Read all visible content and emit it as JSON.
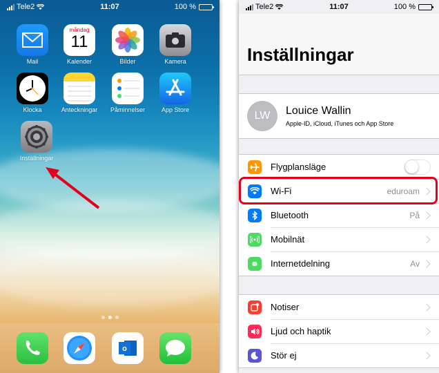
{
  "home": {
    "status": {
      "carrier": "Tele2",
      "time": "11:07",
      "battery": "100 %"
    },
    "apps": [
      {
        "label": "Mail",
        "icon": "mail-icon"
      },
      {
        "label": "Kalender",
        "icon": "calendar-icon",
        "weekday": "måndag",
        "day": "11"
      },
      {
        "label": "Bilder",
        "icon": "photos-icon"
      },
      {
        "label": "Kamera",
        "icon": "camera-icon"
      },
      {
        "label": "Klocka",
        "icon": "clock-icon"
      },
      {
        "label": "Anteckningar",
        "icon": "notes-icon"
      },
      {
        "label": "Påminnelser",
        "icon": "reminders-icon"
      },
      {
        "label": "App Store",
        "icon": "app-store-icon"
      },
      {
        "label": "Inställningar",
        "icon": "settings-gear-icon"
      }
    ],
    "dock": [
      {
        "icon": "phone-icon"
      },
      {
        "icon": "safari-icon"
      },
      {
        "icon": "outlook-icon"
      },
      {
        "icon": "messages-icon"
      }
    ],
    "annotation_color": "#e3001b"
  },
  "settings": {
    "status": {
      "carrier": "Tele2",
      "time": "11:07",
      "battery": "100 %"
    },
    "title": "Inställningar",
    "profile": {
      "initials": "LW",
      "name": "Louice Wallin",
      "subtitle": "Apple-ID, iCloud, iTunes och App Store"
    },
    "group1": [
      {
        "label": "Flygplansläge",
        "value": "",
        "icon": "airplane-icon",
        "color": "#ff9500",
        "toggle": false
      },
      {
        "label": "Wi-Fi",
        "value": "eduroam",
        "icon": "wifi-icon",
        "color": "#007aff"
      },
      {
        "label": "Bluetooth",
        "value": "På",
        "icon": "bluetooth-icon",
        "color": "#007aff"
      },
      {
        "label": "Mobilnät",
        "value": "",
        "icon": "cellular-icon",
        "color": "#4cd964"
      },
      {
        "label": "Internetdelning",
        "value": "Av",
        "icon": "hotspot-icon",
        "color": "#4cd964"
      }
    ],
    "group2": [
      {
        "label": "Notiser",
        "icon": "notifications-icon",
        "color": "#ff3b30"
      },
      {
        "label": "Ljud och haptik",
        "icon": "sounds-icon",
        "color": "#ff2d55"
      },
      {
        "label": "Stör ej",
        "icon": "do-not-disturb-icon",
        "color": "#5856d6"
      }
    ],
    "highlight_color": "#e3001b"
  }
}
